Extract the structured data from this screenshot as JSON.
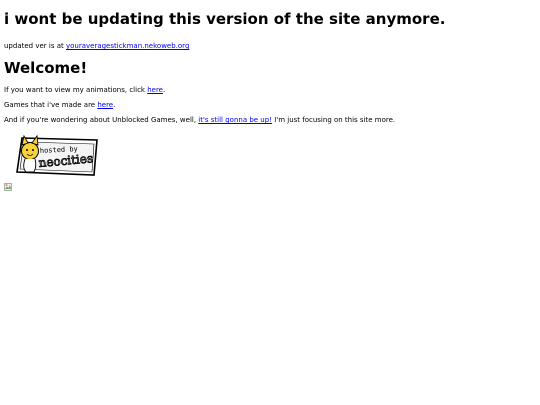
{
  "notice": {
    "heading": "i wont be updating this version of the site anymore."
  },
  "updated": {
    "prefix": "updated ver is at ",
    "link": "youraveragestickman.nekoweb.org"
  },
  "welcome": {
    "heading": "Welcome!"
  },
  "animations": {
    "prefix": "If you want to view my animations, click ",
    "link": "here",
    "suffix": "."
  },
  "games": {
    "prefix": "Games that i've made are ",
    "link": "here",
    "suffix": "."
  },
  "unblocked": {
    "prefix": "And if you're wondering about Unblocked Games, well, ",
    "link": "it's still gonna be up!",
    "suffix": " I'm just focusing on this site more."
  },
  "badge": {
    "text": "hosted by neocities",
    "icon": "neocities-cat-badge"
  },
  "broken_image": {
    "icon": "broken-image-icon"
  }
}
